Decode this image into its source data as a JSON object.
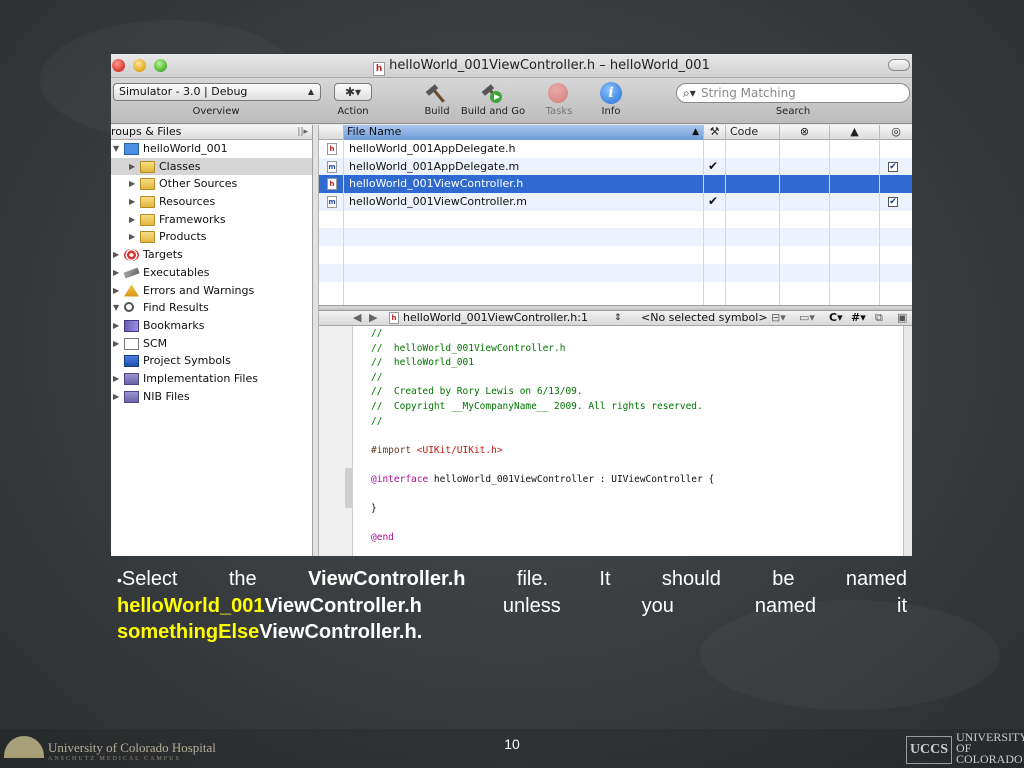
{
  "window": {
    "title": "helloWorld_001ViewController.h – helloWorld_001",
    "title_file_badge": "h"
  },
  "toolbar": {
    "overview_value": "Simulator - 3.0 | Debug",
    "overview_label": "Overview",
    "action_glyph": "✱▾",
    "action_label": "Action",
    "build_label": "Build",
    "build_and_go_label": "Build and Go",
    "tasks_label": "Tasks",
    "info_label": "Info",
    "info_glyph": "i",
    "search_placeholder": "String Matching",
    "search_label": "Search"
  },
  "sidebar": {
    "header": "roups & Files",
    "items": [
      {
        "label": "helloWorld_001",
        "level": 0,
        "icon": "project-icon",
        "expanded": true
      },
      {
        "label": "Classes",
        "level": 1,
        "icon": "folder-icon",
        "selected": true
      },
      {
        "label": "Other Sources",
        "level": 1,
        "icon": "folder-icon"
      },
      {
        "label": "Resources",
        "level": 1,
        "icon": "folder-icon"
      },
      {
        "label": "Frameworks",
        "level": 1,
        "icon": "folder-icon"
      },
      {
        "label": "Products",
        "level": 1,
        "icon": "folder-icon"
      },
      {
        "label": "Targets",
        "level": 0,
        "icon": "target-icon"
      },
      {
        "label": "Executables",
        "level": 0,
        "icon": "executable-icon"
      },
      {
        "label": "Errors and Warnings",
        "level": 0,
        "icon": "warning-icon"
      },
      {
        "label": "Find Results",
        "level": 0,
        "icon": "find-icon",
        "expanded": true
      },
      {
        "label": "Bookmarks",
        "level": 0,
        "icon": "bookmark-icon"
      },
      {
        "label": "SCM",
        "level": 0,
        "icon": "scm-icon"
      },
      {
        "label": "Project Symbols",
        "level": 0,
        "icon": "symbols-icon",
        "no_triangle": true
      },
      {
        "label": "Implementation Files",
        "level": 0,
        "icon": "smart-group-icon"
      },
      {
        "label": "NIB Files",
        "level": 0,
        "icon": "smart-group-icon"
      }
    ]
  },
  "file_list": {
    "columns": {
      "file_name": "File Name",
      "code": "Code"
    },
    "rows": [
      {
        "name": "helloWorld_001AppDelegate.h",
        "type": "h",
        "built": false,
        "target": false
      },
      {
        "name": "helloWorld_001AppDelegate.m",
        "type": "m",
        "built": true,
        "target": true
      },
      {
        "name": "helloWorld_001ViewController.h",
        "type": "h",
        "built": false,
        "target": false,
        "selected": true
      },
      {
        "name": "helloWorld_001ViewController.m",
        "type": "m",
        "built": true,
        "target": true
      }
    ]
  },
  "editor": {
    "nav_file": "helloWorld_001ViewController.h:1",
    "nav_symbol": "<No selected symbol>",
    "code_lines": [
      {
        "cls": "c",
        "text": "//"
      },
      {
        "cls": "c",
        "text": "//  helloWorld_001ViewController.h"
      },
      {
        "cls": "c",
        "text": "//  helloWorld_001"
      },
      {
        "cls": "c",
        "text": "//"
      },
      {
        "cls": "c",
        "text": "//  Created by Rory Lewis on 6/13/09."
      },
      {
        "cls": "c",
        "text": "//  Copyright __MyCompanyName__ 2009. All rights reserved."
      },
      {
        "cls": "c",
        "text": "//"
      },
      {
        "cls": "pl",
        "text": ""
      },
      {
        "cls": "import",
        "text": "#import <UIKit/UIKit.h>"
      },
      {
        "cls": "pl",
        "text": ""
      },
      {
        "cls": "interface",
        "text": "@interface helloWorld_001ViewController : UIViewController {"
      },
      {
        "cls": "pl",
        "text": ""
      },
      {
        "cls": "pl",
        "text": "}"
      },
      {
        "cls": "pl",
        "text": ""
      },
      {
        "cls": "kw",
        "text": "@end"
      }
    ]
  },
  "caption": {
    "bullet": "•",
    "line1_a": "Select the ",
    "line1_b": "ViewController.h",
    "line1_c": " file. It should be named",
    "line2_a": "helloWorld_001",
    "line2_b": "ViewController.h",
    "line2_c": " unless you named it",
    "line3_a": "somethingElse",
    "line3_b": "ViewController.h."
  },
  "footer": {
    "page_number": "10",
    "left_logo_text": "University of Colorado Hospital",
    "left_logo_subtext": "ANSCHUTZ MEDICAL CAMPUS",
    "right_logo_uccs": "UCCS",
    "right_logo_text": "UNIVERSITY\nOF\nCOLORADO"
  },
  "colors": {
    "selection_blue": "#2f6ad1",
    "caption_highlight": "#ffff00",
    "comment_green": "#007400",
    "keyword_purple": "#aa0d91",
    "string_red": "#c41a16"
  }
}
